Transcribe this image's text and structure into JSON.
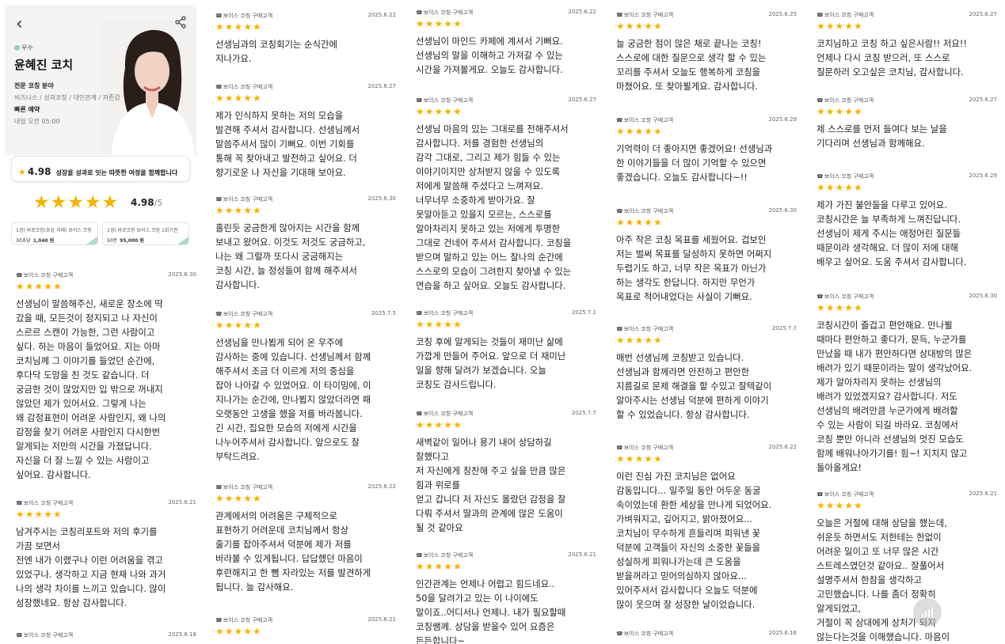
{
  "colors": {
    "star": "#f5b301",
    "accent_mint": "#a9dcc9"
  },
  "profile": {
    "back_icon": "chevron-left-icon",
    "share_icon": "share-icon",
    "badge": "우수",
    "name": "윤혜진 코치",
    "field_label": "전문 코칭 분야",
    "field_value": "비즈니스 / 성과코칭 / 대인관계 / 자존감",
    "booking_label": "빠른 예약",
    "booking_value": "내일 오전 05:00",
    "slogan_rating": "4.98",
    "slogan_text": "성장을 성과로 잇는 따뜻한 여정을 함께합니다",
    "rating_score": "4.98",
    "rating_max": "/5",
    "rating_stars": 5
  },
  "products": [
    {
      "title": "1경) 바로코칭(초당 과제) 보이스 코칭",
      "unit": "30초당",
      "price": "1,040 원"
    },
    {
      "title": "1경) 바로코칭 보이스 코칭 1회기권",
      "unit": "50분",
      "price": "95,000 원"
    }
  ],
  "review_label": "보이스 코칭 구매고객",
  "columns": [
    [
      {
        "date": "2025.6.30",
        "text": "선생님이 말씀해주신, 새로운 장소에 딱\n갔을 때, 모든것이 정지되고 나 자신이\n스르르 스캔이 가능한, 그런 사람이고\n싶다. 하는 마음이 들었어요. 지는 아마\n코치님께 그 이야기를 들었던 순간에,\n후다닥 도망을 친 것도 같습니다. 더\n궁금한 것이 많았지만 입 밖으로 꺼내지\n않았던 제가 있어서요. 그렇게 나는\n왜 감정표현이 어려운 사람인지, 왜 나의\n감정을 찾기 어려운 사람인지 다시한번\n알게되는 저만의 시간을 가졌답니다.\n자신을 더 잘 느낄 수 있는 사람이고\n싶어요. 감사합니다."
      },
      {
        "date": "2025.6.21",
        "text": "남겨주시는 코칭리포트와 저의 후기를\n가끔 보면서\n전엔 내가 이랬구나 이런 어려움을 겪고\n있었구나. 생각하고 지금 현재 나와 과거\n나의 생각 차이를 느끼고 있습니다.  많이\n성장했네요. 항상 감사합니다."
      },
      {
        "date": "2025.6.18",
        "text": ""
      }
    ],
    [
      {
        "date": "2025.6.22",
        "text": "선생님과의 코칭회기는 순식간에\n지나가요."
      },
      {
        "date": "2025.6.27",
        "text": "제가 인식하지 못하는 저의 모습을\n발견해 주셔서 감사합니다. 선생님께서\n말씀주셔서 많이 기뻐요. 이번 기회를\n통해 꼭 찾아내고 발전하고 싶어요. 더\n향기로운 나 자신을 기대해 보아요."
      },
      {
        "date": "2025.6.30",
        "text": "홀린듯  궁금한게 많아지는 시간을 함께\n보내고 왔어요. 이것도 저것도 궁금하고,\n나는 왜 그럴까 또다시 궁금해지는\n코칭 시간, 늘 정성들여 함께 해주셔서\n감사합니다."
      },
      {
        "date": "2025.7.5",
        "text": "선생님을 만나뵙게 되어 온 우주에\n감사하는 중에 있습니다. 선생님께서 함께\n해주셔서 조금 더 이르게 저의 중심을\n잡아 나아갈 수 있었어요. 이 타이밍에, 이\n지나가는 순간에, 만나뵙지 않았더라면 패\n오랫동안 고생을 했을 저를 바라봅니다.\n긴 시간, 집요한 모습의 저에게 시간을\n나누어주셔서 감사합니다. 앞으로도 잘\n부탁드려요."
      },
      {
        "date": "2025.6.22",
        "text": "관계에서의 어려움은 구체적으로\n표현하기 어려운데 코치님께서 항상\n줄기를 잡아주셔서 덕분에 제가 저를\n바라볼 수 있게됩니다. 답답했던 마음이\n후련해지고 한 뼘 자라있는 저를 발견하게\n됩니다. 늘 감사해요."
      },
      {
        "date": "2025.6.21",
        "text": ""
      }
    ],
    [
      {
        "date": "2025.6.22",
        "text": "선생님이 마인드 카페에 계셔서 기뻐요.\n선생님의 말을 이해하고 가져갈 수 있는\n시간을 가져볼게요. 오늘도 감사합니다."
      },
      {
        "date": "2025.6.27",
        "text": "선생님 마음의 있는 그대로를 전해주셔서\n감사합니다. 저를 경험한 선생님의\n감각 그대로, 그리고 제가 힘들 수 있는\n이야기이지만 상처받지 않을 수 있도록\n저에게 말씀해 주셨다고 느껴져요.\n너무너무 소중하게 받아가요. 잘\n못알아듣고  있을지 모르는, 스스로를\n알아차리지 못하고 있는 저에게 투명한\n그대로 건네어 주셔서 감사합니다. 코칭을\n받으며 말하고 있는 어느 찰나의 순간에\n스스로의 모습이 그려한지 찾아낼 수 있는\n연습을 하고 싶어요. 오늘도 감사합니다."
      },
      {
        "date": "2025.7.1",
        "text": "코칭 후에 알게되는 것들이 재미난 삶에\n가깝게 만들어 주어요. 앞으로 더 재미난\n일을 향해 달려가 보겠습니다. 오늘\n코칭도 감사드립니다."
      },
      {
        "date": "2025.7.7",
        "text": "새벽같이 일어나 용기 내어 상담하길\n잘했다고\n저 자신에게 칭찬해 주고 싶을 만큼 많은\n힘과 위로를\n얻고 갑니다  저 자신도 몰랐던 감정을 잘\n다뤄 주셔서 딸과의 관계에   많은 도움이\n될 것 같아요"
      },
      {
        "date": "2025.6.21",
        "text": "인간관계는 언제나 어렵고 힘드네요..\n50을 달려가고 있는 이 나이에도\n말이죠..어디서나 언제나. 내가 필요할때\n코칭쌤께. 상담을 받을수 있어 요즘은\n든든합니다~"
      }
    ],
    [
      {
        "date": "2025.6.25",
        "text": "늘 궁금한 점이 많은 채로 끝나는 코칭!\n스스로에 대한 질문으로 생각 할 수 있는\n꼬리를 주셔서 오늘도 행복하게 코칭을\n마쳤어요. 또 찾아뵐게요. 감사합니다."
      },
      {
        "date": "2025.6.29",
        "text": "기억력이 더 좋아지면 좋겠어요! 선생님과\n한 이야기들을 더 많이 기억할 수 있으면\n좋겠습니다. 오늘도 감사합니다~!!"
      },
      {
        "date": "2025.6.30",
        "text": "아주 작은 코칭 목표를 세웠어요. 겁보인\n저는 벌써 목표를 달성하지 못하면 어쩌지\n두렵기도 하고, 너무 작은 목표가 아닌가\n하는 생각도 한답니다. 하지만 무언가\n목표로 적어내었다는 사실이 기뻐요."
      },
      {
        "date": "2025.7.7",
        "text": "매번 선생님께 코칭받고 있습니다.\n선생님과 함께라면 안전하고 편안한\n지름길로 문제 해결을 할 수있고 잘텍같이\n알아주시는 선생님 덕분에 편하게 이야기\n할  수 있었습니다. 항상 감사합니다."
      },
      {
        "date": "2025.6.22",
        "text": "이런 진심 가진 코치님은 없어요\n감동입니다... 일주일 동안 어두운 동굴\n속이었는데 환한 세상을 만나게 되었어요.\n가벼워지고, 깊어지고, 밝아졌어요...\n코치님이 무수하게 흔들리며 피워낸 꽃\n덕분에 고객들이 자신의 소중한 꽃들을\n성실하게 피워나가는데 큰 도움을\n받을꺼라고 믿어의심하지 않아요...\n있어주셔서 감사합니다 오늘도 덕분에\n많이 웃으며 잘 성장한 날이었습니다."
      },
      {
        "date": "2025.6.16",
        "text": ""
      }
    ],
    [
      {
        "date": "2025.6.27",
        "text": "코치님하고 코칭 하고 싶은사람!! 저요!!\n언제나 다시 코칭 받으러, 또 스스로\n질문하러 오고싶은 코치님, 감사합니다."
      },
      {
        "date": "2025.6.27",
        "text": "제 스스로를 먼저 들여다 보는 날을\n기다리며 선생님과 함께해요."
      },
      {
        "date": "2025.6.29",
        "text": "제가 가진 불안들을 다루고 있어요.\n코칭시간은 늘 부족하게 느껴진답니다.\n선생님이 제게 주시는 애정어린 질문들\n때문이라 생각해요. 더 많이 저에 대해\n배우고 싶어요. 도움 주셔서 감사합니다."
      },
      {
        "date": "2025.6.30",
        "text": "코칭시간이 즐겁고 편안해요. 만나뵐\n때마다 편안하고 좋다가, 문득, 누군가를\n만났을 때 내가 편안하다면 상대방의 많은\n배려가 있기 때문이라는 말이 생각났어요.\n제가 알아차리지 못하는 선생님의\n배려가 있었겠지요? 감사합니다. 저도\n선생님의 배려만큼 누군가에게 배려할\n수 있는 사람이 되길 바라요. 코칭에서\n코칭 뿐만 아니라 선생님의 멋진 모습도\n함께 배워나아가기를! 힘~! 지치지 않고\n돌아올게요!"
      },
      {
        "date": "2025.6.21",
        "text": "오늘은 거절에 대해 상담을 했는데,\n쉬운듯 하면서도 저한테는 한없이\n어려운 일이고 또 너무 많은 시간\n스트레스였던것 같아요.. 잘풀어서\n설명주셔서 한참을 생각하고\n고민했습니다. 나를 좀더 정확히\n알게되었고,\n거절이 꼭 상대에게 상처가 되지\n않는다는것을 이해했습니다. 마음이"
      }
    ]
  ]
}
